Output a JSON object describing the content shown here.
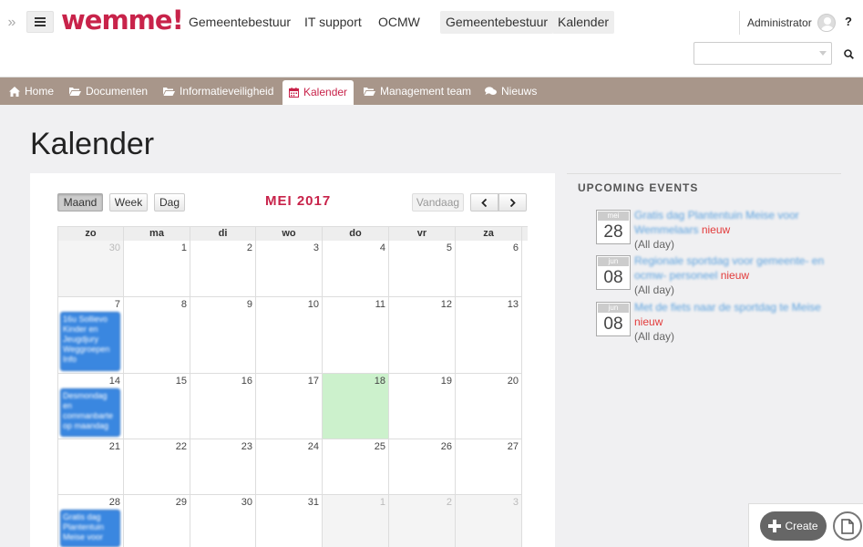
{
  "header": {
    "logo": "wemme!",
    "nav_links": [
      "Gemeentebestuur",
      "IT support",
      "OCMW"
    ],
    "nav_buttons": [
      "Gemeentebestuur",
      "Kalender"
    ],
    "user_name": "Administrator",
    "help": "?",
    "search_placeholder": ""
  },
  "section_nav": [
    {
      "label": "Home",
      "icon": "home-icon"
    },
    {
      "label": "Documenten",
      "icon": "folder-icon"
    },
    {
      "label": "Informatieveiligheid",
      "icon": "folder-icon"
    },
    {
      "label": "Kalender",
      "icon": "calendar-icon",
      "active": true
    },
    {
      "label": "Management team",
      "icon": "folder-icon"
    },
    {
      "label": "Nieuws",
      "icon": "comments-icon"
    }
  ],
  "page_title": "Kalender",
  "calendar": {
    "views": [
      "Maand",
      "Week",
      "Dag"
    ],
    "active_view": "Maand",
    "month_title": "MEI 2017",
    "today_label": "Vandaag",
    "weekdays": [
      "zo",
      "ma",
      "di",
      "wo",
      "do",
      "vr",
      "za"
    ],
    "weeks": [
      [
        {
          "d": "30",
          "other": true
        },
        {
          "d": "1"
        },
        {
          "d": "2"
        },
        {
          "d": "3"
        },
        {
          "d": "4"
        },
        {
          "d": "5"
        },
        {
          "d": "6"
        }
      ],
      [
        {
          "d": "7"
        },
        {
          "d": "8"
        },
        {
          "d": "9"
        },
        {
          "d": "10"
        },
        {
          "d": "11"
        },
        {
          "d": "12"
        },
        {
          "d": "13"
        }
      ],
      [
        {
          "d": "14"
        },
        {
          "d": "15"
        },
        {
          "d": "16"
        },
        {
          "d": "17"
        },
        {
          "d": "18",
          "today": true
        },
        {
          "d": "19"
        },
        {
          "d": "20"
        }
      ],
      [
        {
          "d": "21"
        },
        {
          "d": "22"
        },
        {
          "d": "23"
        },
        {
          "d": "24"
        },
        {
          "d": "25"
        },
        {
          "d": "26"
        },
        {
          "d": "27"
        }
      ],
      [
        {
          "d": "28"
        },
        {
          "d": "29"
        },
        {
          "d": "30"
        },
        {
          "d": "31"
        },
        {
          "d": "1",
          "other": true
        },
        {
          "d": "2",
          "other": true
        },
        {
          "d": "3",
          "other": true
        }
      ]
    ],
    "events": [
      {
        "week": 1,
        "day": 0,
        "text": "16u Sollievo Kinder en Jeugdjury Weggroepen Info"
      },
      {
        "week": 2,
        "day": 0,
        "text": "Desmondag en commanbarte op maandag"
      },
      {
        "week": 4,
        "day": 0,
        "text": "Gratis dag Plantentuin Meise voor"
      }
    ]
  },
  "upcoming": {
    "title": "UPCOMING EVENTS",
    "items": [
      {
        "month": "mei",
        "day": "28",
        "title": "Gratis dag Plantentuin Meise voor Wemmelaars",
        "badge": "nieuw",
        "time": "(All day)"
      },
      {
        "month": "jun",
        "day": "08",
        "title": "Regionale sportdag voor gemeente- en ocmw- personeel",
        "badge": "nieuw",
        "time": "(All day)"
      },
      {
        "month": "jun",
        "day": "08",
        "title": "Met de fiets naar de sportdag te Meise",
        "badge": "nieuw",
        "time": "(All day)"
      }
    ]
  },
  "fab": {
    "create_label": "Create"
  },
  "colors": {
    "brand": "#c8234a",
    "nav_bg": "#a8968a",
    "event_blue": "#3a87e0",
    "today_green": "#ccf1cc"
  }
}
